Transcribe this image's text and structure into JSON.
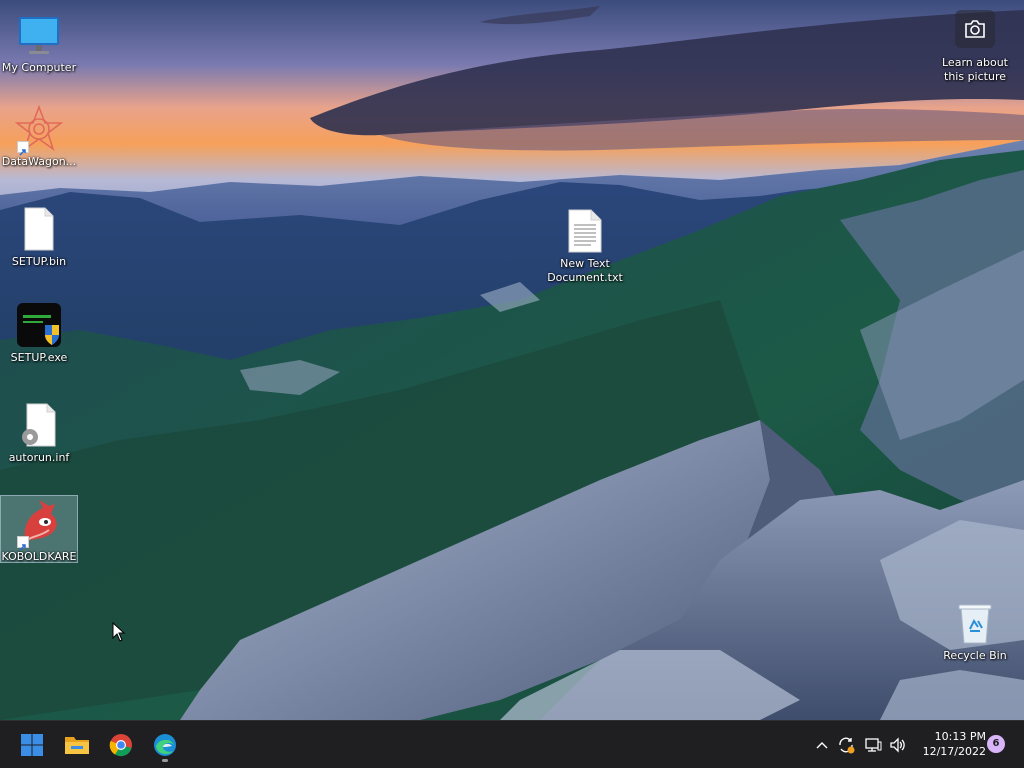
{
  "desktop": {
    "icons": [
      {
        "name": "my-computer",
        "label": "My Computer"
      },
      {
        "name": "datawagon",
        "label": "DataWagon..."
      },
      {
        "name": "setup-bin",
        "label": "SETUP.bin"
      },
      {
        "name": "setup-exe",
        "label": "SETUP.exe"
      },
      {
        "name": "autorun-inf",
        "label": "autorun.inf"
      },
      {
        "name": "koboldkare",
        "label": "KOBOLDKARE"
      },
      {
        "name": "new-text-document",
        "label": "New Text Document.txt"
      },
      {
        "name": "recycle-bin",
        "label": "Recycle Bin"
      }
    ],
    "learn_about_picture": {
      "label": "Learn about this picture",
      "icon": "camera-icon"
    }
  },
  "taskbar": {
    "apps": [
      {
        "name": "start-button",
        "icon": "windows-logo-icon"
      },
      {
        "name": "file-explorer-button",
        "icon": "folder-icon"
      },
      {
        "name": "chrome-button",
        "icon": "chrome-icon"
      },
      {
        "name": "edge-button",
        "icon": "edge-icon"
      }
    ],
    "tray": {
      "icons": [
        "chevron-up-icon",
        "sync-icon",
        "network-icon",
        "volume-icon"
      ],
      "time": "10:13 PM",
      "date": "12/17/2022",
      "notification_count": "6"
    }
  },
  "colors": {
    "taskbar_bg": "#1f1f22",
    "accent_blue": "#3a8ee6",
    "badge": "#d8b4f8"
  }
}
